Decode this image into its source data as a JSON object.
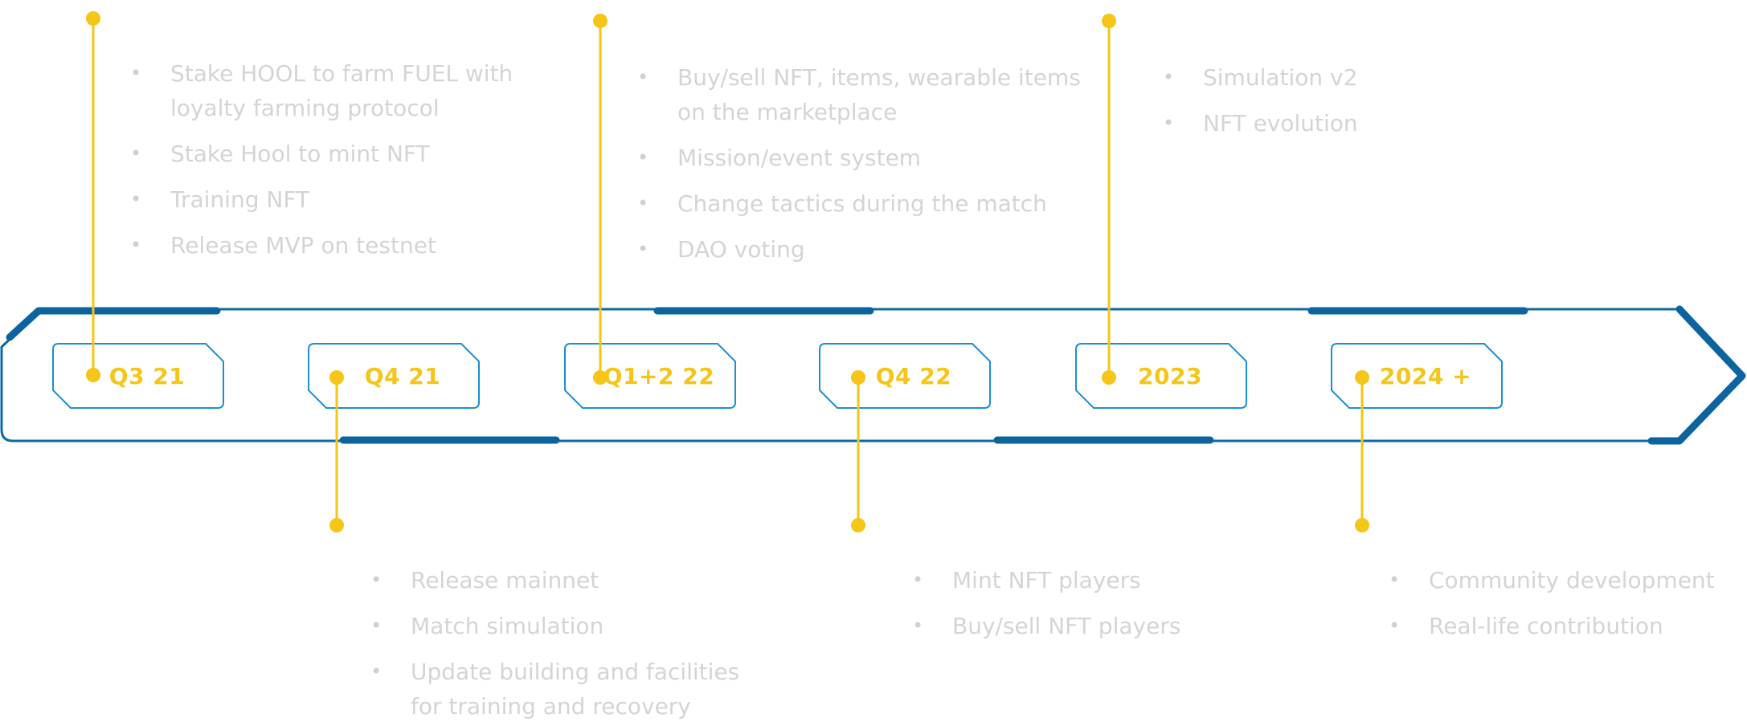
{
  "colors": {
    "rail": "#0c6aa6",
    "rail_thick": "#0b64a0",
    "label_border": "#1a8fd6",
    "accent": "#f5c518",
    "text_muted": "#d4d4d4"
  },
  "milestones": [
    {
      "label": "Q3 21",
      "position": "top",
      "items": [
        "Stake HOOL to farm FUEL with loyalty farming protocol",
        "Stake Hool to mint NFT",
        "Training NFT",
        "Release MVP on testnet"
      ]
    },
    {
      "label": "Q4 21",
      "position": "bottom",
      "items": [
        "Release mainnet",
        "Match simulation",
        "Update building and facilities for training and recovery"
      ]
    },
    {
      "label": "Q1+2 22",
      "position": "top",
      "items": [
        "Buy/sell NFT, items, wearable items on the marketplace",
        "Mission/event system",
        "Change tactics during the match",
        "DAO voting"
      ]
    },
    {
      "label": "Q4 22",
      "position": "bottom",
      "items": [
        "Mint NFT players",
        "Buy/sell NFT players"
      ]
    },
    {
      "label": "2023",
      "position": "top",
      "items": [
        "Simulation v2",
        "NFT evolution"
      ]
    },
    {
      "label": "2024 +",
      "position": "bottom",
      "items": [
        "Community development",
        "Real-life contribution"
      ]
    }
  ]
}
